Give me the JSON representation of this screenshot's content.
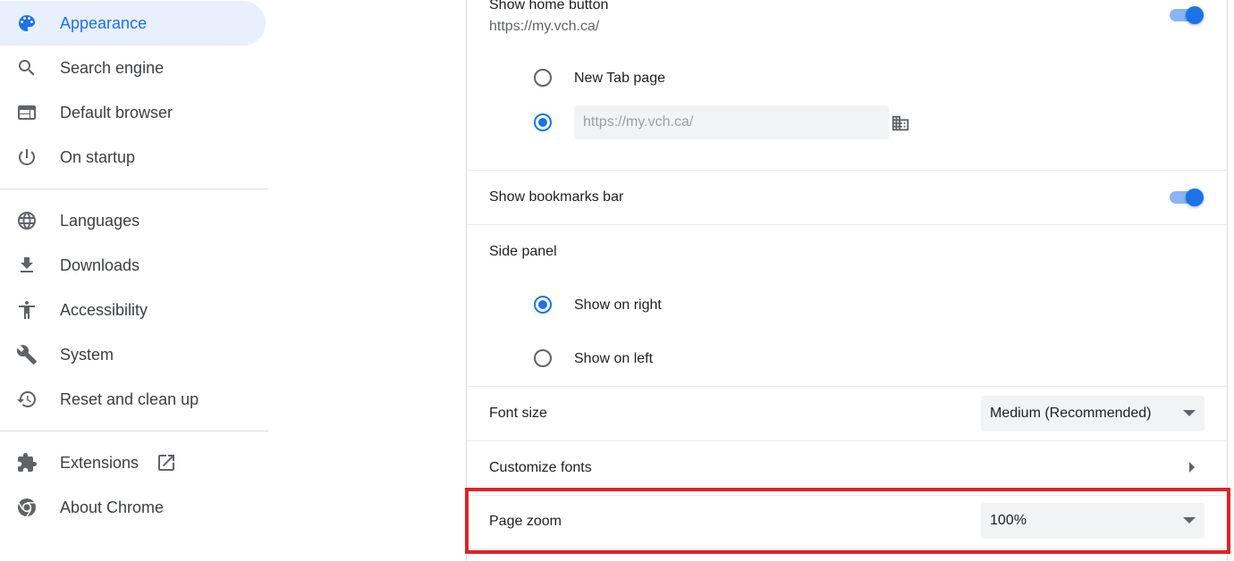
{
  "sidebar": {
    "items": [
      {
        "label": "Appearance",
        "icon": "palette-icon"
      },
      {
        "label": "Search engine",
        "icon": "search-icon"
      },
      {
        "label": "Default browser",
        "icon": "browser-window-icon"
      },
      {
        "label": "On startup",
        "icon": "power-icon"
      },
      {
        "label": "Languages",
        "icon": "globe-icon"
      },
      {
        "label": "Downloads",
        "icon": "download-icon"
      },
      {
        "label": "Accessibility",
        "icon": "accessibility-icon"
      },
      {
        "label": "System",
        "icon": "wrench-icon"
      },
      {
        "label": "Reset and clean up",
        "icon": "history-icon"
      },
      {
        "label": "Extensions",
        "icon": "puzzle-icon"
      },
      {
        "label": "About Chrome",
        "icon": "chrome-icon"
      }
    ],
    "active_item": "Appearance"
  },
  "settings": {
    "home_button": {
      "label": "Show home button",
      "value": "https://my.vch.ca/",
      "enabled": true,
      "options": {
        "new_tab": "New Tab page",
        "custom_url_placeholder": "https://my.vch.ca/"
      },
      "selected_option": "custom_url"
    },
    "bookmarks_bar": {
      "label": "Show bookmarks bar",
      "enabled": true
    },
    "side_panel": {
      "label": "Side panel",
      "right": "Show on right",
      "left": "Show on left",
      "selected": "right"
    },
    "font_size": {
      "label": "Font size",
      "value": "Medium (Recommended)"
    },
    "customize_fonts": {
      "label": "Customize fonts"
    },
    "page_zoom": {
      "label": "Page zoom",
      "value": "100%"
    }
  },
  "colors": {
    "accent": "#1a73e8",
    "active_bg": "#e8f0fe",
    "highlight_border": "#e02226"
  }
}
